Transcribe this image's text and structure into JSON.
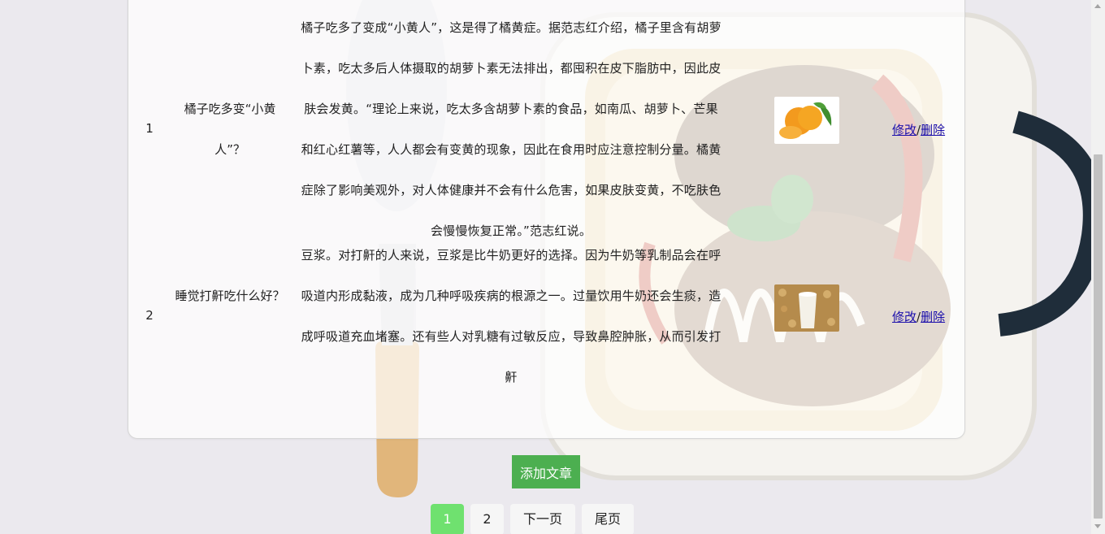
{
  "articles": [
    {
      "id": "1",
      "title": "橘子吃多变“小黄人”？",
      "content": "橘子吃多了变成“小黄人”，这是得了橘黄症。据范志红介绍，橘子里含有胡萝卜素，吃太多后人体摄取的胡萝卜素无法排出，都囤积在皮下脂肪中，因此皮肤会发黄。“理论上来说，吃太多含胡萝卜素的食品，如南瓜、胡萝卜、芒果和红心红薯等，人人都会有变黄的现象，因此在食用时应注意控制分量。橘黄症除了影响美观外，对人体健康并不会有什么危害，如果皮肤变黄，不吃肤色会慢慢恢复正常。”范志红说。",
      "thumb_icon": "tangerine-image",
      "edit_label": "修改",
      "separator": "/",
      "delete_label": "删除"
    },
    {
      "id": "2",
      "title": "睡觉打鼾吃什么好？",
      "content": "豆浆。对打鼾的人来说，豆浆是比牛奶更好的选择。因为牛奶等乳制品会在呼吸道内形成黏液，成为几种呼吸疾病的根源之一。过量饮用牛奶还会生痰，造成呼吸道充血堵塞。还有些人对乳糖有过敏反应，导致鼻腔肿胀，从而引发打鼾",
      "thumb_icon": "soy-milk-image",
      "edit_label": "修改",
      "separator": "/",
      "delete_label": "删除"
    }
  ],
  "add_button_label": "添加文章",
  "pagination": {
    "pages": [
      "1",
      "2"
    ],
    "current": "1",
    "next_label": "下一页",
    "last_label": "尾页"
  },
  "colors": {
    "add_button": "#4caf50",
    "active_page": "#6fe16f",
    "link": "#1a0dab"
  }
}
